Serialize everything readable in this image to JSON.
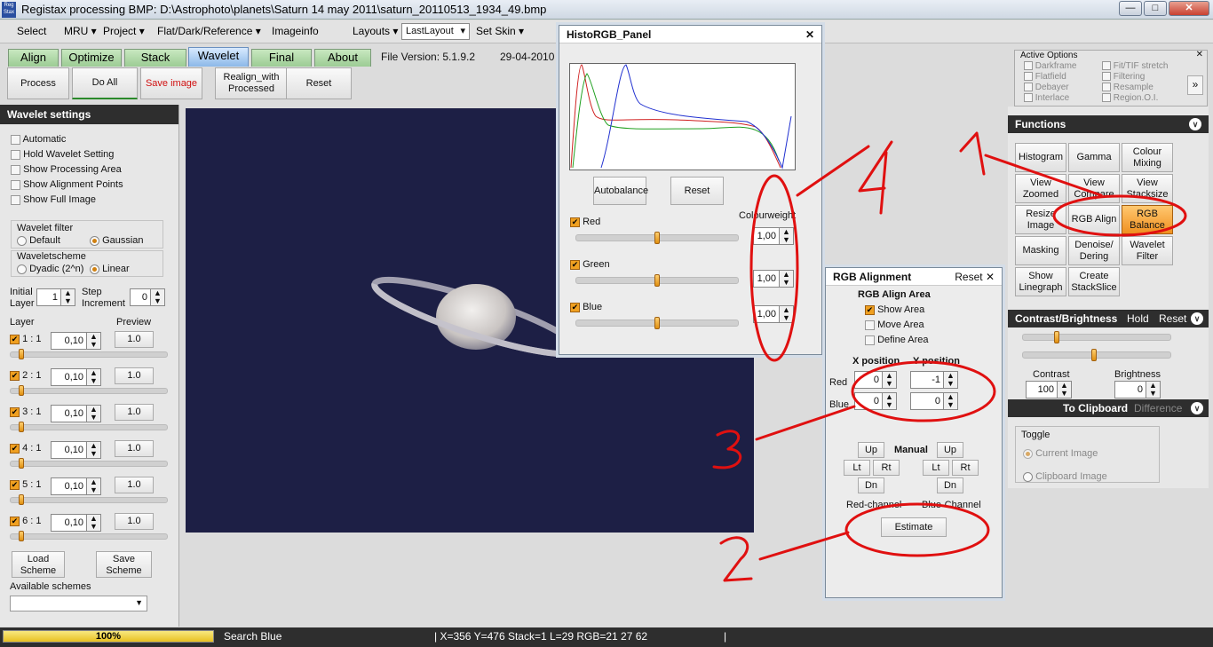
{
  "window": {
    "title": "Registax processing BMP: D:\\Astrophoto\\planets\\Saturn 14 may 2011\\saturn_20110513_1934_49.bmp",
    "app_icon": "Reg Stax"
  },
  "menubar": {
    "items": [
      "Select",
      "MRU",
      "Project",
      "Flat/Dark/Reference",
      "Imageinfo",
      "Layouts",
      "Set Skin"
    ],
    "layout_value": "LastLayout"
  },
  "tabs": [
    "Align",
    "Optimize",
    "Stack",
    "Wavelet",
    "Final",
    "About"
  ],
  "version": {
    "label": "File Version: 5.1.9.2",
    "date": "29-04-2010"
  },
  "toolbar": {
    "process": "Process",
    "doall": "Do All",
    "save": "Save image",
    "realign": "Realign_with Processed",
    "reset": "Reset"
  },
  "wavelet": {
    "title": "Wavelet settings",
    "options": [
      "Automatic",
      "Hold Wavelet Setting",
      "Show Processing Area",
      "Show Alignment Points",
      "Show Full Image"
    ],
    "filter_label": "Wavelet filter",
    "filter_default": "Default",
    "filter_gaussian": "Gaussian",
    "scheme_label": "Waveletscheme",
    "scheme_dyadic": "Dyadic (2^n)",
    "scheme_linear": "Linear",
    "initial_layer_label": "Initial Layer",
    "initial_layer": "1",
    "step_label": "Step Increment",
    "step": "0",
    "layer_label": "Layer",
    "preview_label": "Preview",
    "layers": [
      {
        "name": "1 : 1",
        "value": "0,10",
        "preview": "1.0"
      },
      {
        "name": "2 : 1",
        "value": "0,10",
        "preview": "1.0"
      },
      {
        "name": "3 : 1",
        "value": "0,10",
        "preview": "1.0"
      },
      {
        "name": "4 : 1",
        "value": "0,10",
        "preview": "1.0"
      },
      {
        "name": "5 : 1",
        "value": "0,10",
        "preview": "1.0"
      },
      {
        "name": "6 : 1",
        "value": "0,10",
        "preview": "1.0"
      }
    ],
    "load": "Load Scheme",
    "save": "Save Scheme",
    "available": "Available schemes"
  },
  "histo": {
    "title": "HistoRGB_Panel",
    "autobalance": "Autobalance",
    "reset": "Reset",
    "colourweight": "Colourweight",
    "channels": [
      {
        "name": "Red",
        "value": "1,00"
      },
      {
        "name": "Green",
        "value": "1,00"
      },
      {
        "name": "Blue",
        "value": "1,00"
      }
    ]
  },
  "rgbalign": {
    "title": "RGB Alignment",
    "reset": "Reset",
    "area_label": "RGB Align Area",
    "show": "Show Area",
    "move": "Move Area",
    "define": "Define Area",
    "xpos": "X position",
    "ypos": "Y position",
    "red": "Red",
    "blue": "Blue",
    "red_x": "0",
    "red_y": "-1",
    "blue_x": "0",
    "blue_y": "0",
    "up": "Up",
    "lt": "Lt",
    "rt": "Rt",
    "dn": "Dn",
    "manual": "Manual",
    "red_channel": "Red-channel",
    "blue_channel": "Blue-Channel",
    "estimate": "Estimate"
  },
  "active_options": {
    "title": "Active Options",
    "items": [
      "Darkframe",
      "Fit/TIF stretch",
      "Flatfield",
      "Filtering",
      "Debayer",
      "Resample",
      "Interlace",
      "Region.O.I."
    ]
  },
  "functions": {
    "title": "Functions",
    "buttons": [
      "Histogram",
      "Gamma",
      "Colour Mixing",
      "View Zoomed",
      "View Compare",
      "View Stacksize",
      "Resize Image",
      "RGB Align",
      "RGB Balance",
      "Masking",
      "Denoise/ Dering",
      "Wavelet Filter",
      "Show Linegraph",
      "Create StackSlice"
    ]
  },
  "contrast": {
    "title": "Contrast/Brightness",
    "hold": "Hold",
    "reset": "Reset",
    "contrast_label": "Contrast",
    "contrast": "100",
    "brightness_label": "Brightness",
    "brightness": "0"
  },
  "clipboard": {
    "title": "To Clipboard",
    "difference": "Difference",
    "toggle": "Toggle",
    "current": "Current Image",
    "clip": "Clipboard Image"
  },
  "status": {
    "progress": "100%",
    "progress_value": 1.0,
    "search": "Search Blue",
    "coords": "| X=356 Y=476 Stack=1 L=29 RGB=21 27 62"
  },
  "annotations": [
    "1",
    "2",
    "3",
    "4"
  ]
}
